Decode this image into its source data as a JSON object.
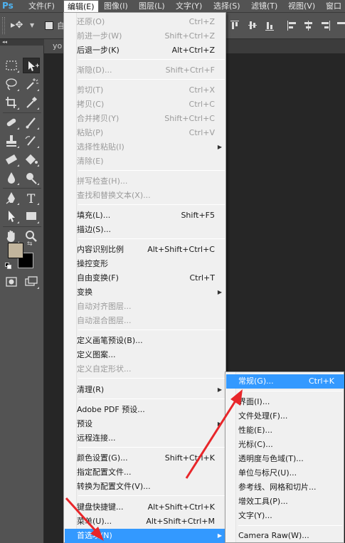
{
  "app": {
    "logo": "Ps"
  },
  "menubar": {
    "items": [
      {
        "label": "文件(F)"
      },
      {
        "label": "编辑(E)"
      },
      {
        "label": "图像(I)"
      },
      {
        "label": "图层(L)"
      },
      {
        "label": "文字(Y)"
      },
      {
        "label": "选择(S)"
      },
      {
        "label": "滤镜(T)"
      },
      {
        "label": "视图(V)"
      },
      {
        "label": "窗口"
      }
    ]
  },
  "options": {
    "auto_label": "自"
  },
  "document": {
    "tab_label": "yo"
  },
  "toolbox": {
    "fg_color": "#c2b59d",
    "bg_color": "#000000"
  },
  "edit_menu": {
    "items": [
      {
        "label": "还原(O)",
        "shortcut": "Ctrl+Z",
        "disabled": true
      },
      {
        "label": "前进一步(W)",
        "shortcut": "Shift+Ctrl+Z",
        "disabled": true
      },
      {
        "label": "后退一步(K)",
        "shortcut": "Alt+Ctrl+Z",
        "disabled": false
      },
      {
        "label": "渐隐(D)...",
        "shortcut": "Shift+Ctrl+F",
        "disabled": true
      },
      {
        "label": "剪切(T)",
        "shortcut": "Ctrl+X",
        "disabled": true
      },
      {
        "label": "拷贝(C)",
        "shortcut": "Ctrl+C",
        "disabled": true
      },
      {
        "label": "合并拷贝(Y)",
        "shortcut": "Shift+Ctrl+C",
        "disabled": true
      },
      {
        "label": "粘贴(P)",
        "shortcut": "Ctrl+V",
        "disabled": true
      },
      {
        "label": "选择性粘贴(I)",
        "shortcut": "",
        "disabled": true,
        "submenu": true
      },
      {
        "label": "清除(E)",
        "shortcut": "",
        "disabled": true
      },
      {
        "label": "拼写检查(H)...",
        "shortcut": "",
        "disabled": true
      },
      {
        "label": "查找和替换文本(X)...",
        "shortcut": "",
        "disabled": true
      },
      {
        "label": "填充(L)...",
        "shortcut": "Shift+F5",
        "disabled": false
      },
      {
        "label": "描边(S)...",
        "shortcut": "",
        "disabled": false
      },
      {
        "label": "内容识别比例",
        "shortcut": "Alt+Shift+Ctrl+C",
        "disabled": false
      },
      {
        "label": "操控变形",
        "shortcut": "",
        "disabled": false
      },
      {
        "label": "自由变换(F)",
        "shortcut": "Ctrl+T",
        "disabled": false
      },
      {
        "label": "变换",
        "shortcut": "",
        "disabled": false,
        "submenu": true
      },
      {
        "label": "自动对齐图层...",
        "shortcut": "",
        "disabled": true
      },
      {
        "label": "自动混合图层...",
        "shortcut": "",
        "disabled": true
      },
      {
        "label": "定义画笔预设(B)...",
        "shortcut": "",
        "disabled": false
      },
      {
        "label": "定义图案...",
        "shortcut": "",
        "disabled": false
      },
      {
        "label": "定义自定形状...",
        "shortcut": "",
        "disabled": true
      },
      {
        "label": "清理(R)",
        "shortcut": "",
        "disabled": false,
        "submenu": true
      },
      {
        "label": "Adobe PDF 预设...",
        "shortcut": "",
        "disabled": false
      },
      {
        "label": "预设",
        "shortcut": "",
        "disabled": false,
        "submenu": true
      },
      {
        "label": "远程连接...",
        "shortcut": "",
        "disabled": false
      },
      {
        "label": "颜色设置(G)...",
        "shortcut": "Shift+Ctrl+K",
        "disabled": false
      },
      {
        "label": "指定配置文件...",
        "shortcut": "",
        "disabled": false
      },
      {
        "label": "转换为配置文件(V)...",
        "shortcut": "",
        "disabled": false
      },
      {
        "label": "键盘快捷键...",
        "shortcut": "Alt+Shift+Ctrl+K",
        "disabled": false
      },
      {
        "label": "菜单(U)...",
        "shortcut": "Alt+Shift+Ctrl+M",
        "disabled": false
      },
      {
        "label": "首选项(N)",
        "shortcut": "",
        "disabled": false,
        "submenu": true,
        "highlighted": true
      }
    ]
  },
  "prefs_submenu": {
    "items": [
      {
        "label": "常规(G)...",
        "shortcut": "Ctrl+K",
        "highlighted": true
      },
      {
        "label": "界面(I)...",
        "shortcut": ""
      },
      {
        "label": "文件处理(F)...",
        "shortcut": ""
      },
      {
        "label": "性能(E)...",
        "shortcut": ""
      },
      {
        "label": "光标(C)...",
        "shortcut": ""
      },
      {
        "label": "透明度与色域(T)...",
        "shortcut": ""
      },
      {
        "label": "单位与标尺(U)...",
        "shortcut": ""
      },
      {
        "label": "参考线、网格和切片...",
        "shortcut": ""
      },
      {
        "label": "增效工具(P)...",
        "shortcut": ""
      },
      {
        "label": "文字(Y)...",
        "shortcut": ""
      },
      {
        "label": "Camera Raw(W)...",
        "shortcut": ""
      }
    ]
  },
  "annotation": {
    "arrow_color": "#e8262a"
  }
}
